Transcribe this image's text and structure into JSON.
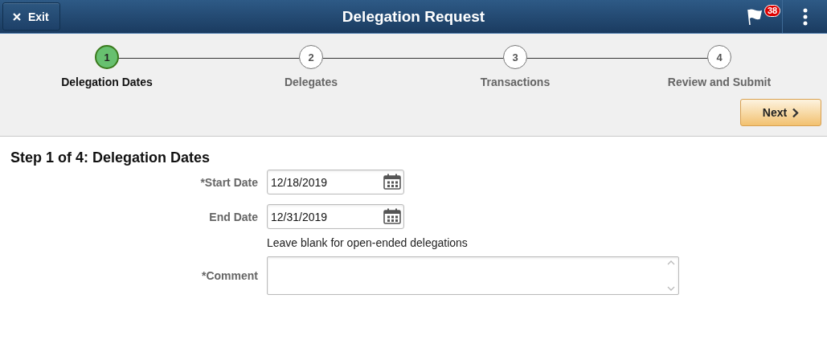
{
  "header": {
    "exit_button": "Exit",
    "title": "Delegation Request",
    "notification_count": "38"
  },
  "steps": [
    {
      "number": "1",
      "label": "Delegation Dates",
      "selected": true
    },
    {
      "number": "2",
      "label": "Delegates",
      "selected": false
    },
    {
      "number": "3",
      "label": "Transactions",
      "selected": false
    },
    {
      "number": "4",
      "label": "Review and Submit",
      "selected": false
    }
  ],
  "next_button": "Next",
  "section_title": "Step 1 of 4: Delegation Dates",
  "fields": [
    {
      "kind": "date",
      "label": "*Start Date",
      "value": "12/18/2019"
    },
    {
      "kind": "date",
      "label": "End Date",
      "value": "12/31/2019"
    },
    {
      "kind": "hint",
      "text": "Leave blank for open-ended delegations"
    },
    {
      "kind": "textarea",
      "label": "*Comment"
    }
  ]
}
